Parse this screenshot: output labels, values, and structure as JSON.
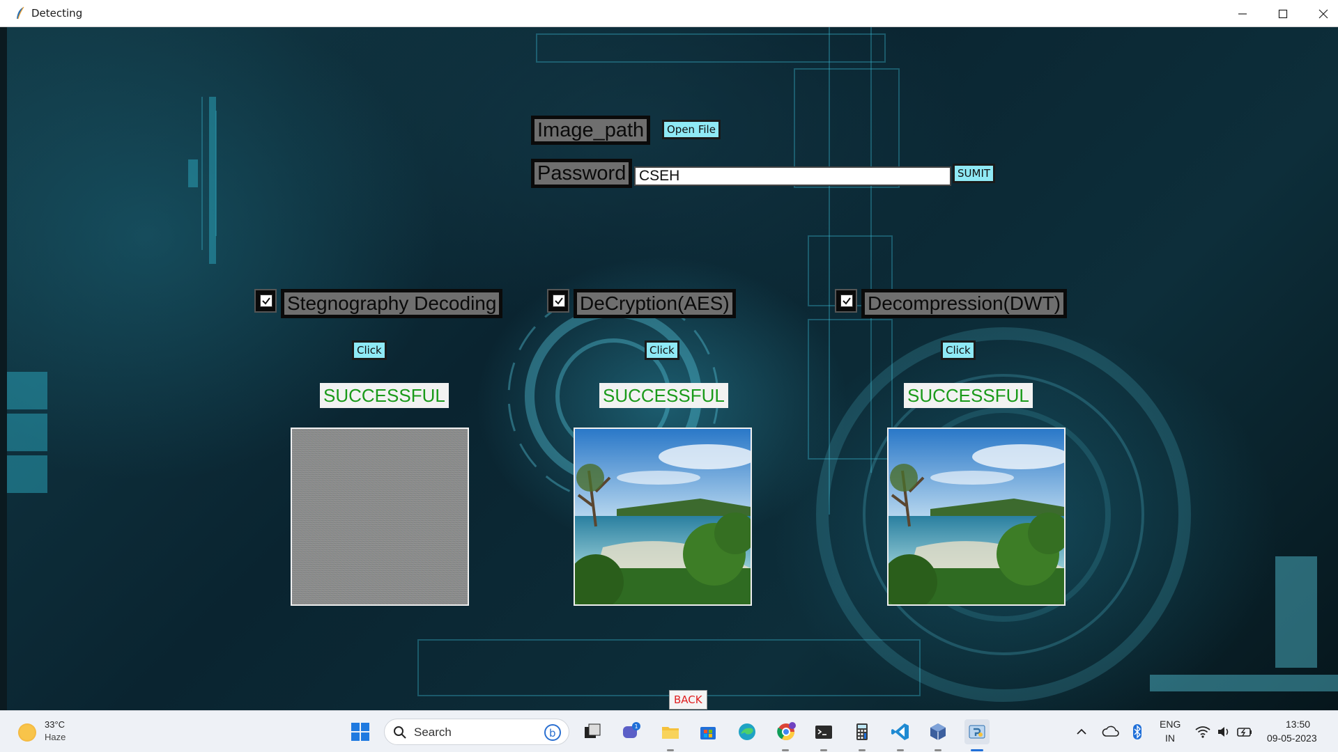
{
  "window": {
    "title": "Detecting"
  },
  "form": {
    "image_path_label": "Image_path",
    "open_file_label": "Open File",
    "password_label": "Password",
    "password_value": "CSEH",
    "submit_label": "SUMIT"
  },
  "stages": [
    {
      "label": "Stegnography Decoding",
      "checked": true,
      "click_label": "Click",
      "status": "SUCCESSFUL"
    },
    {
      "label": "DeCryption(AES)",
      "checked": true,
      "click_label": "Click",
      "status": "SUCCESSFUL"
    },
    {
      "label": "Decompression(DWT)",
      "checked": true,
      "click_label": "Click",
      "status": "SUCCESSFUL"
    }
  ],
  "back_label": "BACK",
  "taskbar": {
    "weather_temp": "33°C",
    "weather_cond": "Haze",
    "search_label": "Search",
    "chat_badge": "1",
    "lang_line1": "ENG",
    "lang_line2": "IN",
    "time": "13:50",
    "date": "09-05-2023"
  },
  "colors": {
    "accent_cyan": "#8fe9f5",
    "success_green": "#1a9a1a",
    "back_red": "#e02020"
  }
}
